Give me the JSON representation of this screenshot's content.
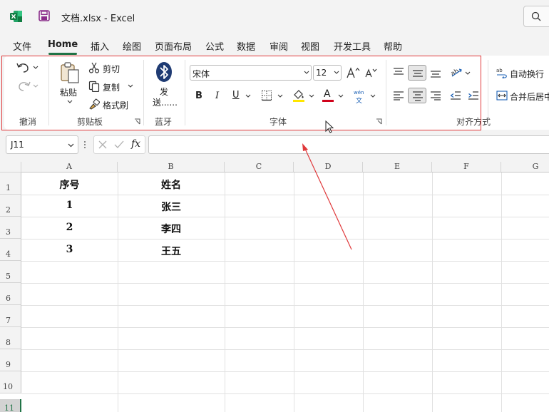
{
  "titlebar": {
    "file_title": "文档.xlsx  -  Excel"
  },
  "menu": {
    "tabs": [
      "文件",
      "Home",
      "插入",
      "绘图",
      "页面布局",
      "公式",
      "数据",
      "审阅",
      "视图",
      "开发工具",
      "帮助"
    ],
    "active": "Home"
  },
  "ribbon": {
    "undo_group": {
      "label": "撤消"
    },
    "clipboard": {
      "label": "剪贴板",
      "paste": "粘贴",
      "cut": "剪切",
      "copy": "复制",
      "format_painter": "格式刷"
    },
    "bluetooth": {
      "label": "蓝牙",
      "send_line1": "发",
      "send_line2": "送......"
    },
    "font": {
      "label": "字体",
      "font_name": "宋体",
      "font_size": "12",
      "bold": "B",
      "italic": "I",
      "underline": "U",
      "font_color_letter": "A",
      "wen_top": "wén",
      "wen_bottom": "文"
    },
    "alignment": {
      "label": "对齐方式",
      "wrap_text": "自动换行",
      "merge_center": "合并后居中"
    }
  },
  "formula_bar": {
    "name_box": "J11",
    "fx": "fx",
    "formula": ""
  },
  "sheet": {
    "columns": [
      "A",
      "B",
      "C",
      "D",
      "E",
      "F",
      "G"
    ],
    "rows": [
      "1",
      "2",
      "3",
      "4",
      "5",
      "6",
      "7",
      "8",
      "9",
      "10",
      "11"
    ],
    "cells": {
      "A1": "序号",
      "B1": "姓名",
      "A2": "1",
      "B2": "张三",
      "A3": "2",
      "B3": "李四",
      "A4": "3",
      "B4": "王五"
    }
  },
  "colors": {
    "accent": "#217346",
    "annotation": "#e0393b",
    "font_color_bar": "#d0021b",
    "highlight_bar": "#ffe600"
  }
}
